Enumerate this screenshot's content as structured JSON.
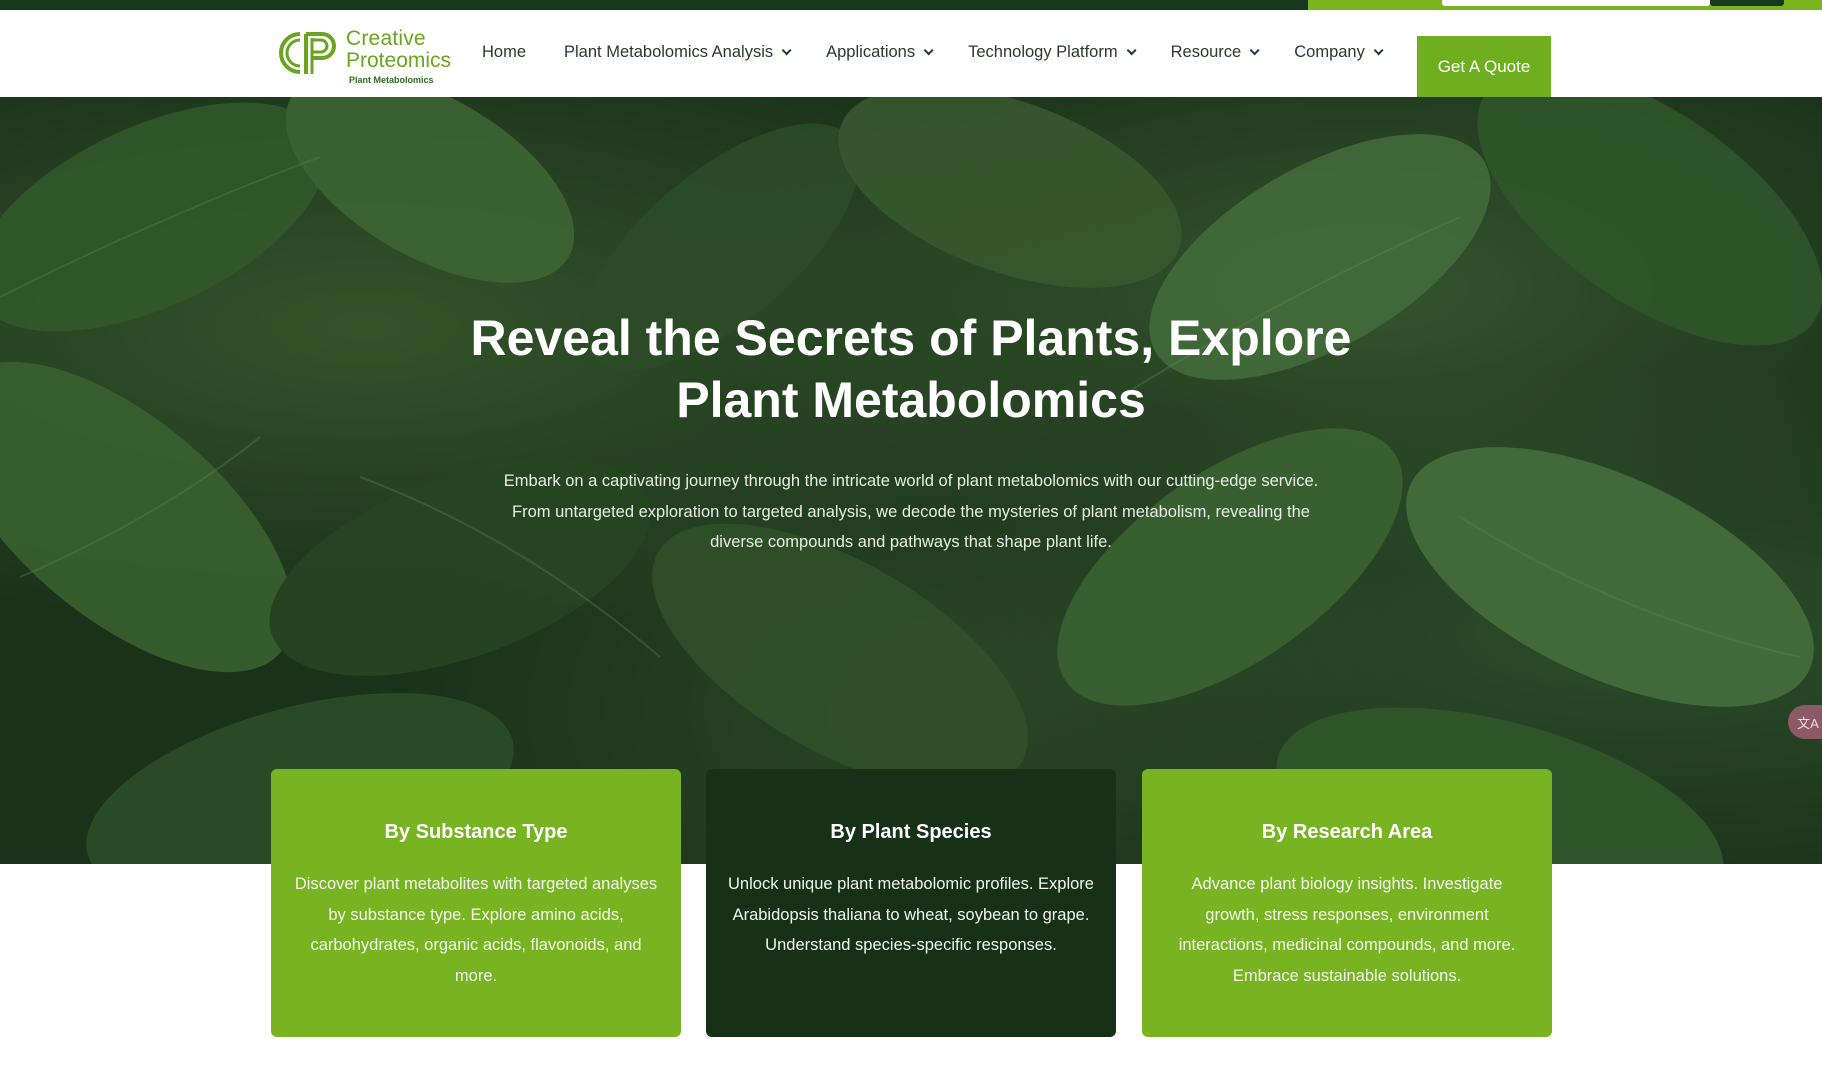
{
  "brand": {
    "line1": "Creative",
    "line2": "Proteomics",
    "tagline": "Plant Metabolomics"
  },
  "nav": {
    "items": [
      {
        "label": "Home",
        "dropdown": false
      },
      {
        "label": "Plant Metabolomics Analysis",
        "dropdown": true
      },
      {
        "label": "Applications",
        "dropdown": true
      },
      {
        "label": "Technology Platform",
        "dropdown": true
      },
      {
        "label": "Resource",
        "dropdown": true
      },
      {
        "label": "Company",
        "dropdown": true
      }
    ],
    "cta_label": "Get A Quote"
  },
  "hero": {
    "title_line1": "Reveal the Secrets of Plants, Explore",
    "title_line2": "Plant Metabolomics",
    "desc_line1": "Embark on a captivating journey through the intricate world of plant metabolomics with our cutting-edge service.",
    "desc_line2": "From untargeted exploration to targeted analysis, we decode the mysteries of plant metabolism, revealing the",
    "desc_line3": "diverse compounds and pathways that shape plant life."
  },
  "cards": [
    {
      "title": "By Substance Type",
      "text": "Discover plant metabolites with targeted analyses by substance type. Explore amino acids, carbohydrates, organic acids, flavonoids, and more."
    },
    {
      "title": "By Plant Species",
      "text": "Unlock unique plant metabolomic profiles. Explore Arabidopsis thaliana to wheat, soybean to grape. Understand species-specific responses."
    },
    {
      "title": "By Research Area",
      "text": "Advance plant biology insights. Investigate growth, stress responses, environment interactions, medicinal compounds, and more. Embrace sustainable solutions."
    }
  ],
  "colors": {
    "brand_green": "#6fae1f",
    "card_green": "#78b421",
    "dark_green": "#163118"
  },
  "icons": {
    "floating": "translate-icon"
  }
}
